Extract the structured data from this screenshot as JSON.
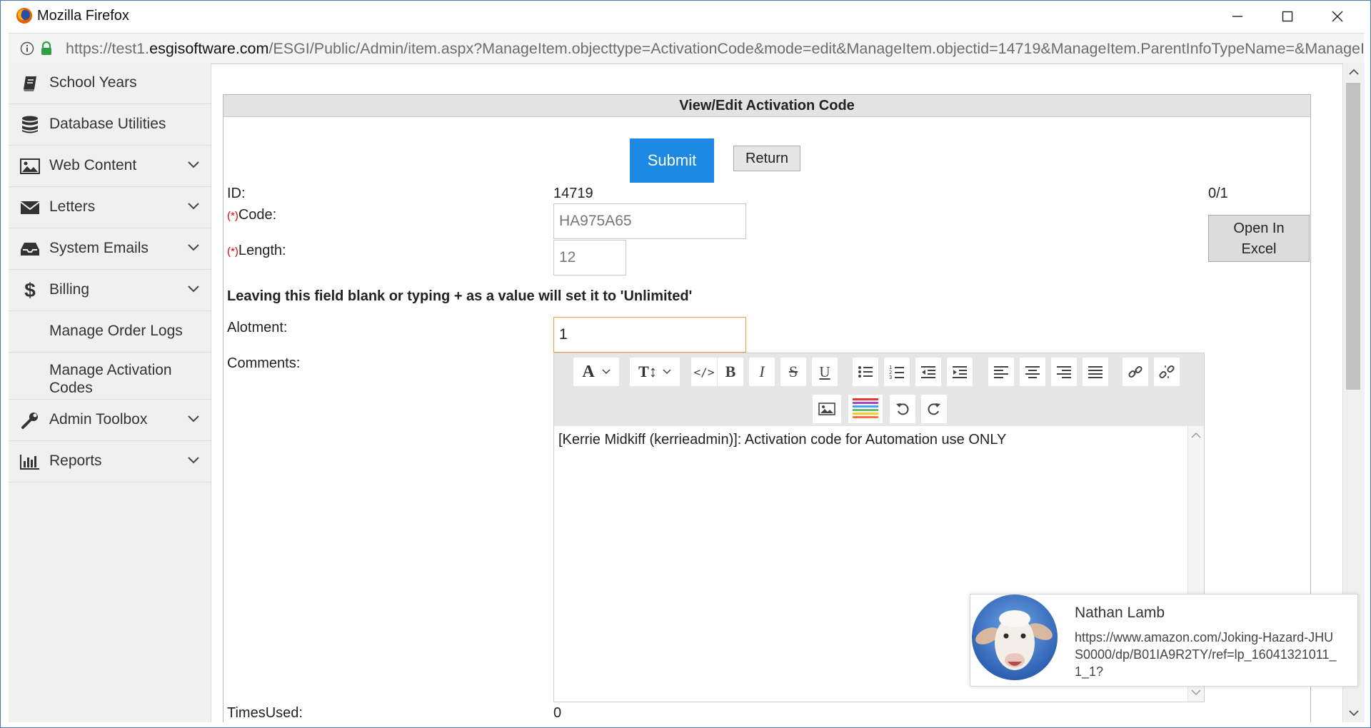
{
  "window": {
    "title": "Mozilla Firefox",
    "url_prefix": "https://test1.",
    "url_domain": "esgisoftware.com",
    "url_rest": "/ESGI/Public/Admin/item.aspx?ManageItem.objecttype=ActivationCode&mode=edit&ManageItem.objectid=14719&ManageItem.ParentInfoTypeName=&ManageItem"
  },
  "sidebar": {
    "items": [
      {
        "label": "School Years",
        "icon": "book-icon",
        "has_chevron": false
      },
      {
        "label": "Database Utilities",
        "icon": "database-icon",
        "has_chevron": false
      },
      {
        "label": "Web Content",
        "icon": "image-icon",
        "has_chevron": true
      },
      {
        "label": "Letters",
        "icon": "envelope-icon",
        "has_chevron": true
      },
      {
        "label": "System Emails",
        "icon": "inbox-icon",
        "has_chevron": true
      },
      {
        "label": "Billing",
        "icon": "dollar-icon",
        "has_chevron": true
      },
      {
        "label": "Manage Order Logs",
        "icon": "",
        "has_chevron": false
      },
      {
        "label": "Manage Activation Codes",
        "icon": "",
        "has_chevron": false
      },
      {
        "label": "Admin Toolbox",
        "icon": "wrench-icon",
        "has_chevron": true
      },
      {
        "label": "Reports",
        "icon": "bar-chart-icon",
        "has_chevron": true
      }
    ]
  },
  "form": {
    "header": "View/Edit  Activation Code",
    "submit_label": "Submit",
    "return_label": "Return",
    "id_label": "ID:",
    "id_value": "14719",
    "counter": "0/1",
    "required_mark": "(*)",
    "code_label": "Code:",
    "code_value": "HA975A65",
    "length_label": "Length:",
    "length_value": "12",
    "note": "Leaving this field blank or typing + as a value will set it to 'Unlimited'",
    "allotment_label": "Alotment:",
    "allotment_value": "1",
    "comments_label": "Comments:",
    "comments_value": "[Kerrie Midkiff (kerrieadmin)]: Activation code for Automation use ONLY",
    "times_used_label": "TimesUsed:",
    "times_used_value": "0",
    "excel_label_1": "Open In",
    "excel_label_2": "Excel"
  },
  "editor_toolbar": [
    "font-icon",
    "text-size-icon",
    "code-icon",
    "bold-icon",
    "italic-icon",
    "strikethrough-icon",
    "underline-icon",
    "bullet-list-icon",
    "numbered-list-icon",
    "outdent-icon",
    "indent-icon",
    "align-left-icon",
    "align-center-icon",
    "align-right-icon",
    "justify-icon",
    "link-icon",
    "unlink-icon",
    "insert-image-icon",
    "color-palette-icon",
    "undo-icon",
    "redo-icon"
  ],
  "notification": {
    "name": "Nathan Lamb",
    "body": "https://www.amazon.com/Joking-Hazard-JHUS0000/dp/B01IA9R2TY/ref=lp_16041321011_1_1?"
  },
  "colors": {
    "accent": "#1e88e5",
    "focus_border": "#f39c3c",
    "required": "#dd0000"
  }
}
